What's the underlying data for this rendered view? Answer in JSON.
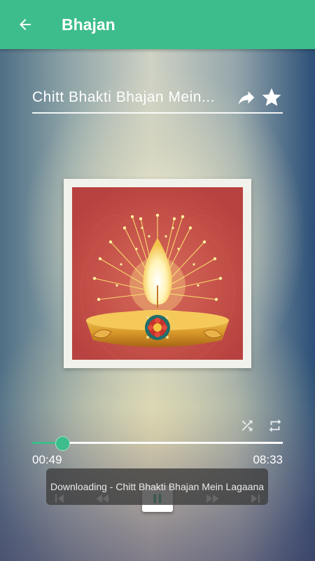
{
  "appbar": {
    "title": "Bhajan",
    "back_icon": "arrow-back-icon"
  },
  "song": {
    "title": "Chitt Bhakti Bhajan Mein...",
    "share_icon": "share-arrow-icon",
    "favorite_icon": "star-icon"
  },
  "artwork": {
    "description_icon": "diya-lamp-icon"
  },
  "controls": {
    "shuffle_icon": "shuffle-icon",
    "repeat_icon": "repeat-icon"
  },
  "player": {
    "current_time": "00:49",
    "total_time": "08:33",
    "progress": 0.117,
    "prev_icon": "skip-previous-icon",
    "rewind_icon": "rewind-icon",
    "play_pause_icon": "pause-icon",
    "forward_icon": "fast-forward-icon",
    "next_icon": "skip-next-icon"
  },
  "toast": {
    "message": "Downloading - Chitt Bhakti Bhajan Mein Lagaana"
  },
  "colors": {
    "accent": "#3dbd8b"
  }
}
